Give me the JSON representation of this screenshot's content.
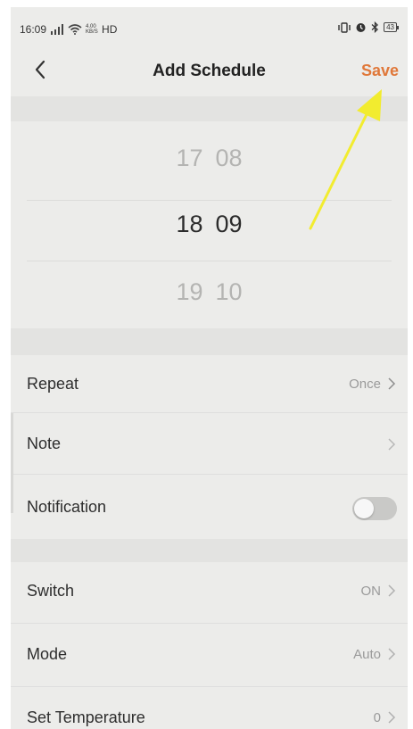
{
  "status_bar": {
    "time": "16:09",
    "signal": "4G",
    "network_rate": "4.00 KB/S",
    "hd": "HD",
    "battery": "43"
  },
  "header": {
    "title": "Add Schedule",
    "save_label": "Save",
    "accent_color": "#e0783a"
  },
  "time_picker": {
    "rows": [
      {
        "hour": "17",
        "minute": "08"
      },
      {
        "hour": "18",
        "minute": "09"
      },
      {
        "hour": "19",
        "minute": "10"
      }
    ],
    "selected": {
      "hour": "18",
      "minute": "09"
    }
  },
  "settings": {
    "repeat": {
      "label": "Repeat",
      "value": "Once"
    },
    "note": {
      "label": "Note",
      "value": ""
    },
    "notification": {
      "label": "Notification",
      "enabled": false
    }
  },
  "device": {
    "switch": {
      "label": "Switch",
      "value": "ON"
    },
    "mode": {
      "label": "Mode",
      "value": "Auto"
    },
    "set_temperature": {
      "label": "Set Temperature",
      "value": "0"
    }
  },
  "annotation": {
    "arrow_color": "#f2ec2f"
  }
}
